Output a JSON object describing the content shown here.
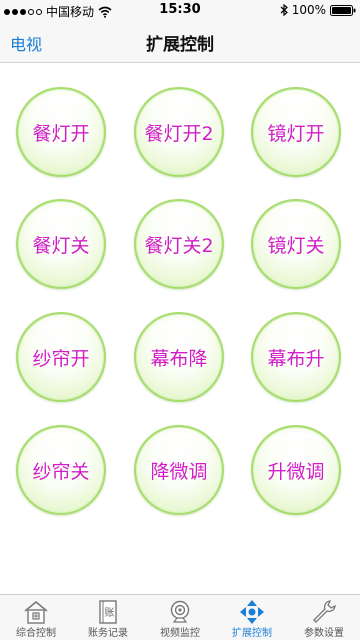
{
  "status_bar": {
    "carrier": "中国移动",
    "time": "15:30",
    "battery": "100%"
  },
  "nav": {
    "back_label": "电视",
    "title": "扩展控制"
  },
  "buttons": [
    "餐灯开",
    "餐灯开2",
    "镜灯开",
    "餐灯关",
    "餐灯关2",
    "镜灯关",
    "纱帘开",
    "幕布降",
    "幕布升",
    "纱帘关",
    "降微调",
    "升微调"
  ],
  "tabs": [
    {
      "label": "综合控制",
      "icon": "home-icon"
    },
    {
      "label": "账务记录",
      "icon": "ledger-icon"
    },
    {
      "label": "视频监控",
      "icon": "camera-icon"
    },
    {
      "label": "扩展控制",
      "icon": "arrows-icon",
      "active": true
    },
    {
      "label": "参数设置",
      "icon": "wrench-icon"
    }
  ],
  "colors": {
    "accent": "#1a7fd6",
    "button_text": "#d11ec8",
    "button_ring": "#a6dd6e"
  }
}
